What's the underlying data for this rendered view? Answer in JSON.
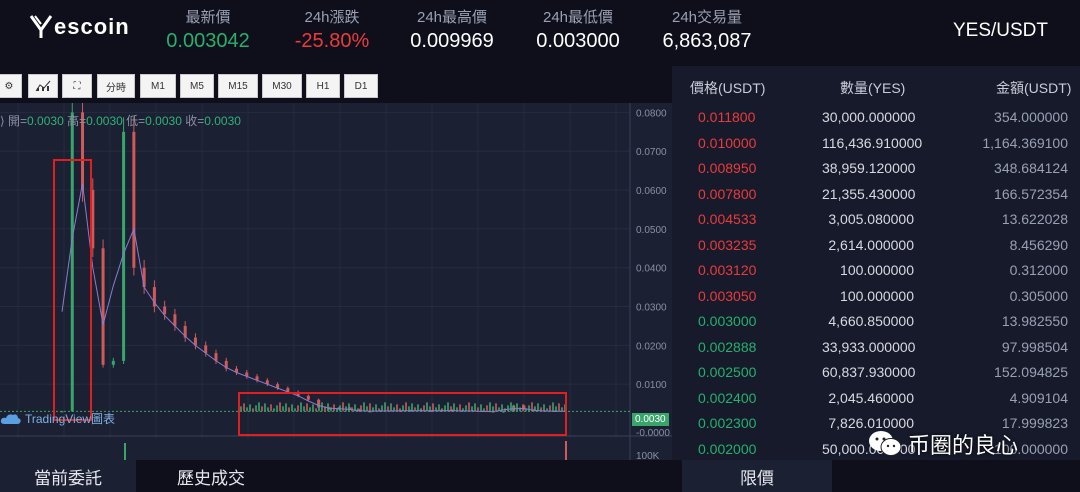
{
  "header": {
    "logo_text": "escoin",
    "stats": [
      {
        "label": "最新價",
        "value": "0.003042",
        "tone": "green"
      },
      {
        "label": "24h漲跌",
        "value": "-25.80%",
        "tone": "red"
      },
      {
        "label": "24h最高價",
        "value": "0.009969",
        "tone": "white"
      },
      {
        "label": "24h最低價",
        "value": "0.003000",
        "tone": "white"
      },
      {
        "label": "24h交易量",
        "value": "6,863,087",
        "tone": "white"
      }
    ],
    "pair": "YES/USDT"
  },
  "toolbar": {
    "buttons": [
      "分時",
      "M1",
      "M5",
      "M15",
      "M30",
      "H1",
      "D1"
    ]
  },
  "chart": {
    "ohlc": {
      "open_label": "開=",
      "open": "0.0030",
      "high_label": "高=",
      "high": "0.0030",
      "low_label": "低=",
      "low": "0.0030",
      "close_label": "收=",
      "close": "0.0030"
    },
    "tradingview_label": "TradingView圖表",
    "current_price_tag": "0.0030",
    "zero_tick": "-0.0000",
    "volume_tick": "100K"
  },
  "chart_data": {
    "type": "candlestick",
    "y_ticks": [
      "0.0800",
      "0.0700",
      "0.0600",
      "0.0500",
      "0.0400",
      "0.0300",
      "0.0200",
      "0.0100"
    ],
    "ylim": [
      0,
      0.085
    ],
    "approx_price_series": [
      0.003,
      0.08,
      0.06,
      0.045,
      0.015,
      0.016,
      0.075,
      0.04,
      0.035,
      0.03,
      0.028,
      0.025,
      0.022,
      0.02,
      0.018,
      0.016,
      0.014,
      0.013,
      0.012,
      0.011,
      0.01,
      0.009,
      0.008,
      0.007,
      0.006,
      0.004,
      0.0035,
      0.004,
      0.0035,
      0.003,
      0.003,
      0.0032,
      0.0031,
      0.003,
      0.0033,
      0.0031,
      0.003,
      0.0034,
      0.003,
      0.0032,
      0.0031,
      0.003,
      0.0028,
      0.003,
      0.0045,
      0.0035,
      0.0032,
      0.003,
      0.0031,
      0.003
    ]
  },
  "orderbook": {
    "headers": {
      "price": "價格(USDT)",
      "qty": "數量(YES)",
      "amount": "金額(USDT)"
    },
    "rows": [
      {
        "price": "0.011800",
        "qty": "30,000.000000",
        "amount": "354.000000",
        "side": "sell"
      },
      {
        "price": "0.010000",
        "qty": "116,436.910000",
        "amount": "1,164.369100",
        "side": "sell"
      },
      {
        "price": "0.008950",
        "qty": "38,959.120000",
        "amount": "348.684124",
        "side": "sell"
      },
      {
        "price": "0.007800",
        "qty": "21,355.430000",
        "amount": "166.572354",
        "side": "sell"
      },
      {
        "price": "0.004533",
        "qty": "3,005.080000",
        "amount": "13.622028",
        "side": "sell"
      },
      {
        "price": "0.003235",
        "qty": "2,614.000000",
        "amount": "8.456290",
        "side": "sell"
      },
      {
        "price": "0.003120",
        "qty": "100.000000",
        "amount": "0.312000",
        "side": "sell"
      },
      {
        "price": "0.003050",
        "qty": "100.000000",
        "amount": "0.305000",
        "side": "sell"
      },
      {
        "price": "0.003000",
        "qty": "4,660.850000",
        "amount": "13.982550",
        "side": "buy"
      },
      {
        "price": "0.002888",
        "qty": "33,933.000000",
        "amount": "97.998504",
        "side": "buy"
      },
      {
        "price": "0.002500",
        "qty": "60,837.930000",
        "amount": "152.094825",
        "side": "buy"
      },
      {
        "price": "0.002400",
        "qty": "2,045.460000",
        "amount": "4.909104",
        "side": "buy"
      },
      {
        "price": "0.002300",
        "qty": "7,826.010000",
        "amount": "17.999823",
        "side": "buy"
      },
      {
        "price": "0.002000",
        "qty": "50,000.000000",
        "amount": "100.000000",
        "side": "buy"
      }
    ]
  },
  "bottom_tabs": {
    "current_orders": "當前委託",
    "history": "歷史成交",
    "limit": "限價"
  },
  "watermark": {
    "text": "币圈的良心"
  },
  "colors": {
    "green": "#25b06b",
    "red": "#ea3b3b",
    "highlight_box": "#e02020"
  }
}
